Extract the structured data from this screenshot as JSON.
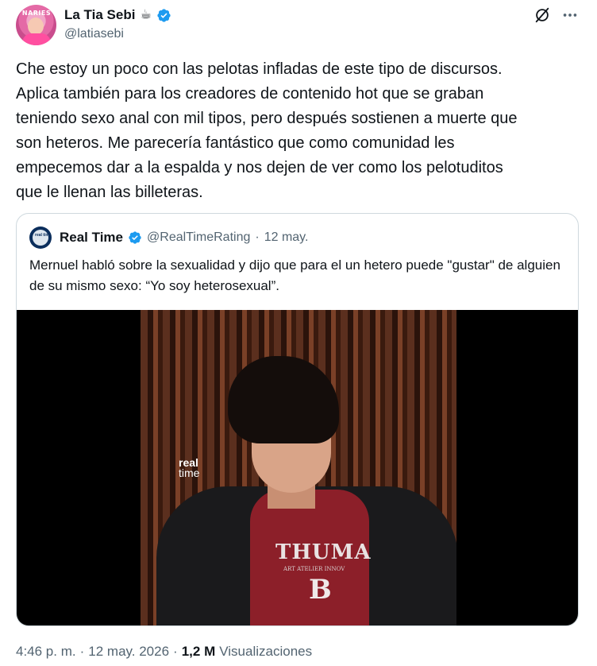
{
  "author": {
    "display_name": "La Tia Sebi",
    "name_emoji": "☕",
    "handle": "@latiasebi",
    "avatar_label": "NARIES"
  },
  "tweet": {
    "text": "Che estoy un poco con las pelotas infladas de este tipo de discursos.\nAplica también para los creadores de contenido hot que se graban\nteniendo sexo anal con mil tipos, pero después sostienen a muerte que\nson heteros. Me parecería fantástico que como comunidad les\nempecemos dar a la espalda y nos dejen de ver como los pelotuditos\nque le llenan las billeteras."
  },
  "quote": {
    "avatar_label": "real time",
    "display_name": "Real Time",
    "handle": "@RealTimeRating",
    "separator": "·",
    "date": "12 may.",
    "text": "Mernuel habló sobre la sexualidad y dijo que para el un hetero puede \"gustar\" de alguien de su mismo sexo: “Yo soy heterosexual”.",
    "media": {
      "watermark_line1": "real",
      "watermark_line2": "time",
      "shirt_text": "THUMA",
      "shirt_subtext": "ART ATELIER INNOV",
      "shirt_letter": "B"
    }
  },
  "meta": {
    "time": "4:46 p. m.",
    "separator": "·",
    "date": "12 may. 2026",
    "separator2": "·",
    "views_count": "1,2 M",
    "views_label": "Visualizaciones"
  },
  "colors": {
    "verified": "#1d9bf0",
    "text_primary": "#0f1419",
    "text_secondary": "#536471",
    "border": "#cfd9de"
  },
  "icons": {
    "verified": "verified-badge-icon",
    "grok": "grok-icon",
    "more": "more-horizontal-icon"
  }
}
